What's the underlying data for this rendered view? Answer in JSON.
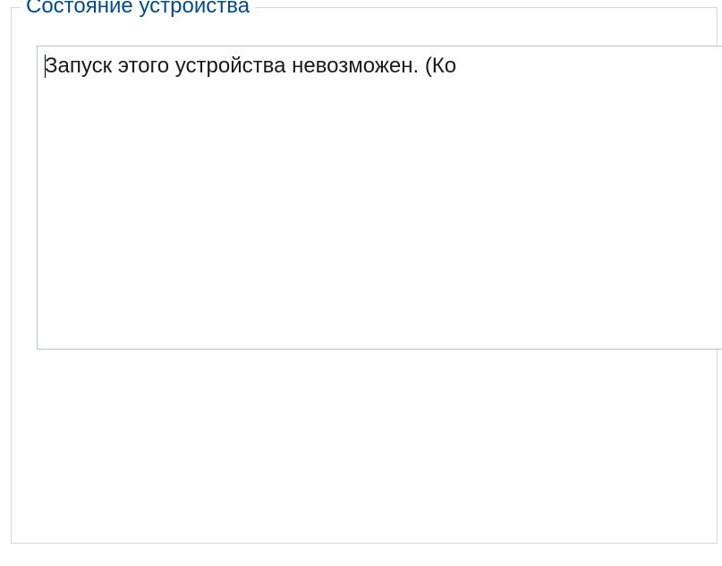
{
  "group": {
    "title": "Состояние устройства"
  },
  "status": {
    "message": "Запуск этого устройства невозможен. (Ко"
  }
}
